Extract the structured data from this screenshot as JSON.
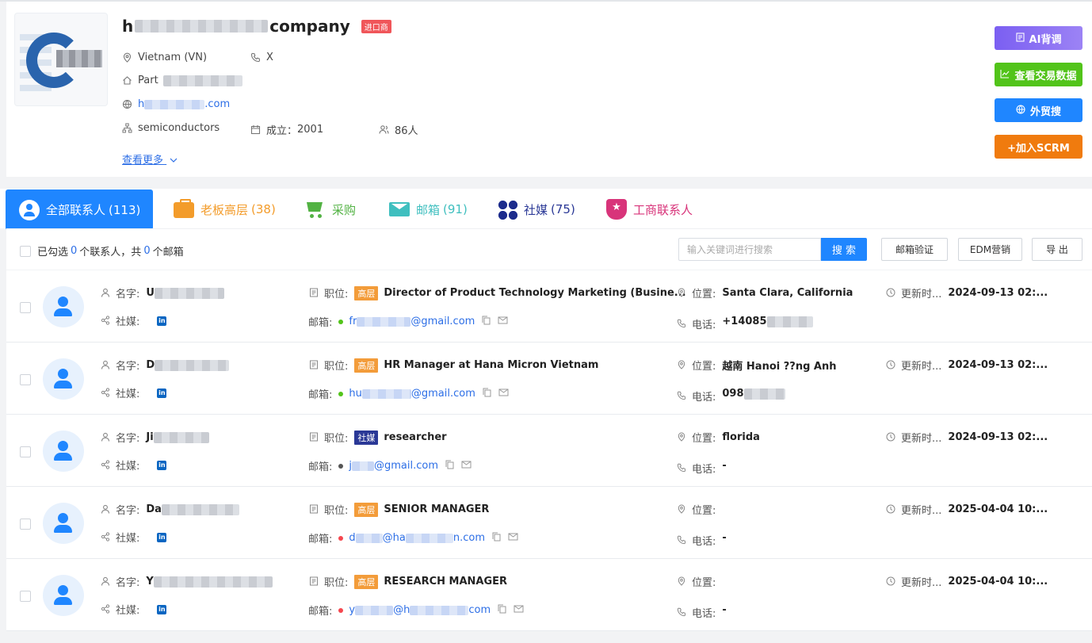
{
  "company": {
    "name_prefix": "h",
    "name_suffix": "company",
    "badge": "进口商",
    "country": "Vietnam (VN)",
    "phone": "X",
    "address_prefix": "Part",
    "website_prefix": "h",
    "website_suffix": ".com",
    "industry": "semiconductors",
    "founded_label": "成立：",
    "founded_year": "2001",
    "employees": "86人",
    "see_more": "查看更多"
  },
  "actions": {
    "ai": "AI背调",
    "trade": "查看交易数据",
    "search": "外贸搜",
    "scrm": "+加入SCRM"
  },
  "tabs": [
    {
      "label": "全部联系人",
      "count": "(113)",
      "color": "#ffffff"
    },
    {
      "label": "老板高层",
      "count": "(38)",
      "color": "#f39c2b"
    },
    {
      "label": "采购",
      "count": "",
      "color": "#52b243"
    },
    {
      "label": "邮箱",
      "count": "(91)",
      "color": "#3fbfbf"
    },
    {
      "label": "社媒",
      "count": "(75)",
      "color": "#2a3896"
    },
    {
      "label": "工商联系人",
      "count": "",
      "color": "#d8347a"
    }
  ],
  "toolbar": {
    "selected_prefix": "已勾选",
    "selected_count": "0",
    "selected_mid": "个联系人，共",
    "email_count": "0",
    "selected_suffix": "个邮箱",
    "search_placeholder": "输入关键词进行搜索",
    "search_button": "搜 索",
    "verify_button": "邮箱验证",
    "edm_button": "EDM营销",
    "export_button": "导 出"
  },
  "labels": {
    "name": "名字:",
    "social": "社媒:",
    "title": "职位:",
    "email": "邮箱:",
    "location": "位置:",
    "phone": "电话:",
    "updated": "更新时..."
  },
  "contacts": [
    {
      "name_prefix": "U",
      "tag": "高层",
      "tag_type": "exec",
      "title": "Director of Product Technology Marketing (Busine...",
      "email_prefix": "fr",
      "email_suffix": "@gmail.com",
      "email_status_color": "#52c41a",
      "location": "Santa Clara, California",
      "phone": "+14085",
      "updated": "2024-09-13 02:..."
    },
    {
      "name_prefix": "D",
      "tag": "高层",
      "tag_type": "exec",
      "title": "HR Manager at Hana Micron Vietnam",
      "email_prefix": "hu",
      "email_suffix": "@gmail.com",
      "email_status_color": "#52c41a",
      "location": "越南 Hanoi ??ng Anh",
      "phone": "098",
      "updated": "2024-09-13 02:..."
    },
    {
      "name_prefix": "Ji",
      "tag": "社媒",
      "tag_type": "social",
      "title": "researcher",
      "email_prefix": "j",
      "email_suffix": "@gmail.com",
      "email_status_color": "#555555",
      "location": "florida",
      "phone": "-",
      "updated": "2024-09-13 02:..."
    },
    {
      "name_prefix": "Da",
      "tag": "高层",
      "tag_type": "exec",
      "title": "SENIOR MANAGER",
      "email_prefix": "d",
      "email_suffix": "n.com",
      "email_mid": "@ha",
      "email_status_color": "#f5474f",
      "location": "",
      "phone": "-",
      "updated": "2025-04-04 10:..."
    },
    {
      "name_prefix": "Y",
      "tag": "高层",
      "tag_type": "exec",
      "title": "RESEARCH MANAGER",
      "email_prefix": "y",
      "email_suffix": "com",
      "email_mid": "@h",
      "email_status_color": "#f5474f",
      "location": "",
      "phone": "-",
      "updated": "2025-04-04 10:..."
    }
  ]
}
